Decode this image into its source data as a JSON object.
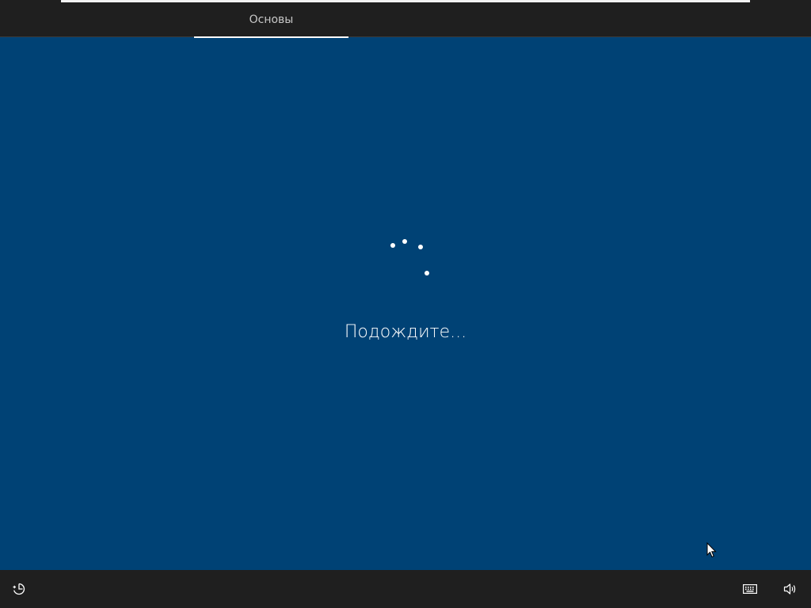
{
  "top_bar": {
    "section_tab_label": "Основы"
  },
  "main": {
    "status_text": "Подождите..."
  },
  "bottom_bar": {
    "accessibility_icon": "accessibility-icon",
    "keyboard_icon": "keyboard-icon",
    "volume_icon": "volume-icon"
  },
  "colors": {
    "background": "#004275",
    "bar_background": "#1f1f1f",
    "text": "#ffffff"
  }
}
